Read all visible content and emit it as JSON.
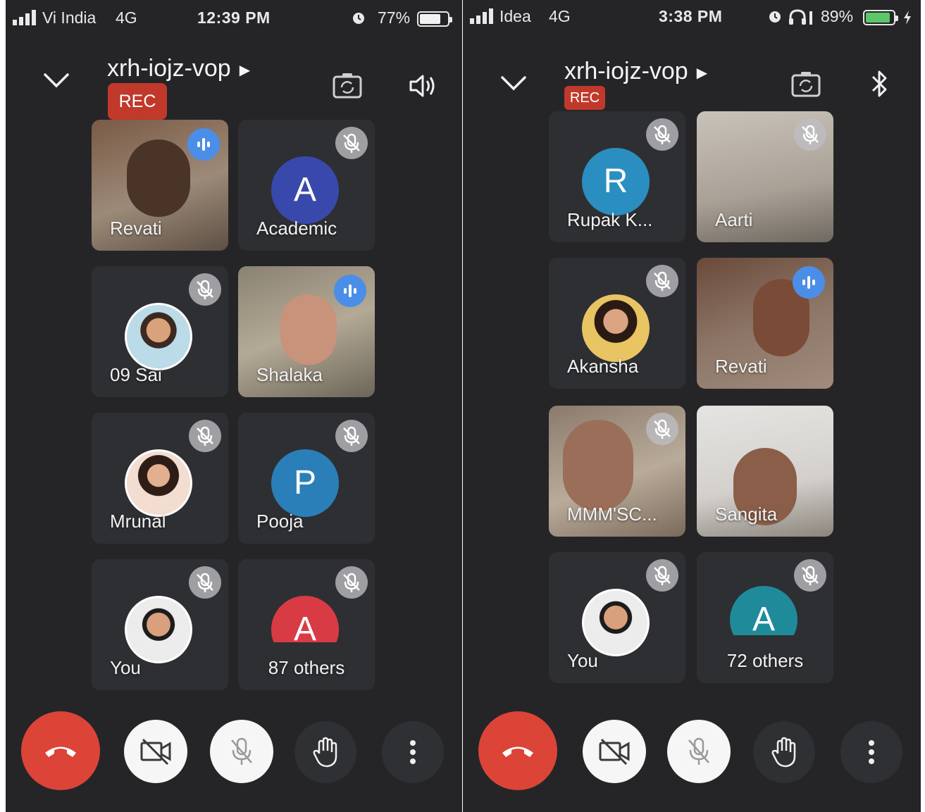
{
  "colors": {
    "background": "#252528",
    "tile": "#2e2f33",
    "rec": "#c0392b",
    "end_call": "#dc4438",
    "speaking": "#4a8ee8"
  },
  "left": {
    "status": {
      "carrier": "Vi India",
      "network": "4G",
      "time": "12:39 PM",
      "battery": "77%",
      "battery_level": 0.77
    },
    "meeting": {
      "code": "xrh-iojz-vop",
      "rec": "REC"
    },
    "tiles": [
      {
        "name": "Revati",
        "state": "speaking",
        "kind": "video"
      },
      {
        "name": "Academic",
        "initial": "A",
        "avatar_color": "#3949ab",
        "state": "muted"
      },
      {
        "name": "09 Sai",
        "state": "muted",
        "kind": "photo"
      },
      {
        "name": "Shalaka",
        "state": "speaking",
        "kind": "video"
      },
      {
        "name": "Mrunal",
        "state": "muted",
        "kind": "photo"
      },
      {
        "name": "Pooja",
        "initial": "P",
        "avatar_color": "#2b7fb8",
        "state": "muted"
      },
      {
        "name": "You",
        "state": "muted",
        "kind": "photo"
      },
      {
        "name": "87 others",
        "initial": "A",
        "avatar_color": "#d93b45",
        "state": "muted",
        "kind": "others"
      }
    ]
  },
  "right": {
    "status": {
      "carrier": "Idea",
      "network": "4G",
      "time": "3:38 PM",
      "battery": "89%",
      "battery_level": 0.89
    },
    "meeting": {
      "code": "xrh-iojz-vop",
      "rec": "REC"
    },
    "tiles": [
      {
        "name": "Rupak K...",
        "initial": "R",
        "avatar_color": "#2b8ec0",
        "state": "muted"
      },
      {
        "name": "Aarti",
        "state": "muted",
        "kind": "video"
      },
      {
        "name": "Akansha",
        "state": "muted",
        "kind": "photo"
      },
      {
        "name": "Revati",
        "state": "speaking",
        "kind": "video"
      },
      {
        "name": "MMM'SC...",
        "state": "muted",
        "kind": "video"
      },
      {
        "name": "Sangita",
        "state": "none",
        "kind": "video"
      },
      {
        "name": "You",
        "state": "muted",
        "kind": "photo"
      },
      {
        "name": "72 others",
        "initial": "A",
        "avatar_color": "#1f8a9a",
        "state": "muted",
        "kind": "others"
      }
    ]
  }
}
